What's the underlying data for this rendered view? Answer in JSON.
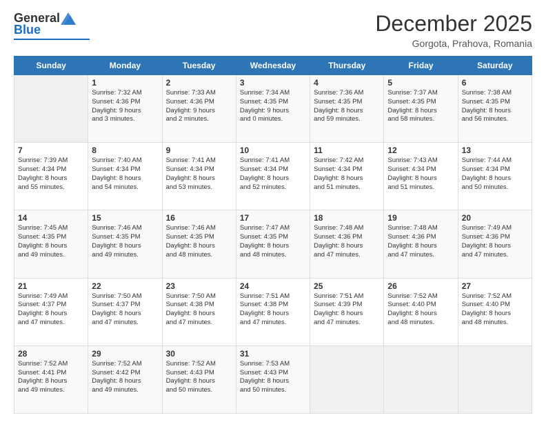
{
  "header": {
    "logo": {
      "general": "General",
      "blue": "Blue"
    },
    "title": "December 2025",
    "location": "Gorgota, Prahova, Romania"
  },
  "days": [
    "Sunday",
    "Monday",
    "Tuesday",
    "Wednesday",
    "Thursday",
    "Friday",
    "Saturday"
  ],
  "weeks": [
    [
      {
        "day": "",
        "content": ""
      },
      {
        "day": "1",
        "content": "Sunrise: 7:32 AM\nSunset: 4:36 PM\nDaylight: 9 hours\nand 3 minutes."
      },
      {
        "day": "2",
        "content": "Sunrise: 7:33 AM\nSunset: 4:36 PM\nDaylight: 9 hours\nand 2 minutes."
      },
      {
        "day": "3",
        "content": "Sunrise: 7:34 AM\nSunset: 4:35 PM\nDaylight: 9 hours\nand 0 minutes."
      },
      {
        "day": "4",
        "content": "Sunrise: 7:36 AM\nSunset: 4:35 PM\nDaylight: 8 hours\nand 59 minutes."
      },
      {
        "day": "5",
        "content": "Sunrise: 7:37 AM\nSunset: 4:35 PM\nDaylight: 8 hours\nand 58 minutes."
      },
      {
        "day": "6",
        "content": "Sunrise: 7:38 AM\nSunset: 4:35 PM\nDaylight: 8 hours\nand 56 minutes."
      }
    ],
    [
      {
        "day": "7",
        "content": "Sunrise: 7:39 AM\nSunset: 4:34 PM\nDaylight: 8 hours\nand 55 minutes."
      },
      {
        "day": "8",
        "content": "Sunrise: 7:40 AM\nSunset: 4:34 PM\nDaylight: 8 hours\nand 54 minutes."
      },
      {
        "day": "9",
        "content": "Sunrise: 7:41 AM\nSunset: 4:34 PM\nDaylight: 8 hours\nand 53 minutes."
      },
      {
        "day": "10",
        "content": "Sunrise: 7:41 AM\nSunset: 4:34 PM\nDaylight: 8 hours\nand 52 minutes."
      },
      {
        "day": "11",
        "content": "Sunrise: 7:42 AM\nSunset: 4:34 PM\nDaylight: 8 hours\nand 51 minutes."
      },
      {
        "day": "12",
        "content": "Sunrise: 7:43 AM\nSunset: 4:34 PM\nDaylight: 8 hours\nand 51 minutes."
      },
      {
        "day": "13",
        "content": "Sunrise: 7:44 AM\nSunset: 4:34 PM\nDaylight: 8 hours\nand 50 minutes."
      }
    ],
    [
      {
        "day": "14",
        "content": "Sunrise: 7:45 AM\nSunset: 4:35 PM\nDaylight: 8 hours\nand 49 minutes."
      },
      {
        "day": "15",
        "content": "Sunrise: 7:46 AM\nSunset: 4:35 PM\nDaylight: 8 hours\nand 49 minutes."
      },
      {
        "day": "16",
        "content": "Sunrise: 7:46 AM\nSunset: 4:35 PM\nDaylight: 8 hours\nand 48 minutes."
      },
      {
        "day": "17",
        "content": "Sunrise: 7:47 AM\nSunset: 4:35 PM\nDaylight: 8 hours\nand 48 minutes."
      },
      {
        "day": "18",
        "content": "Sunrise: 7:48 AM\nSunset: 4:36 PM\nDaylight: 8 hours\nand 47 minutes."
      },
      {
        "day": "19",
        "content": "Sunrise: 7:48 AM\nSunset: 4:36 PM\nDaylight: 8 hours\nand 47 minutes."
      },
      {
        "day": "20",
        "content": "Sunrise: 7:49 AM\nSunset: 4:36 PM\nDaylight: 8 hours\nand 47 minutes."
      }
    ],
    [
      {
        "day": "21",
        "content": "Sunrise: 7:49 AM\nSunset: 4:37 PM\nDaylight: 8 hours\nand 47 minutes."
      },
      {
        "day": "22",
        "content": "Sunrise: 7:50 AM\nSunset: 4:37 PM\nDaylight: 8 hours\nand 47 minutes."
      },
      {
        "day": "23",
        "content": "Sunrise: 7:50 AM\nSunset: 4:38 PM\nDaylight: 8 hours\nand 47 minutes."
      },
      {
        "day": "24",
        "content": "Sunrise: 7:51 AM\nSunset: 4:38 PM\nDaylight: 8 hours\nand 47 minutes."
      },
      {
        "day": "25",
        "content": "Sunrise: 7:51 AM\nSunset: 4:39 PM\nDaylight: 8 hours\nand 47 minutes."
      },
      {
        "day": "26",
        "content": "Sunrise: 7:52 AM\nSunset: 4:40 PM\nDaylight: 8 hours\nand 48 minutes."
      },
      {
        "day": "27",
        "content": "Sunrise: 7:52 AM\nSunset: 4:40 PM\nDaylight: 8 hours\nand 48 minutes."
      }
    ],
    [
      {
        "day": "28",
        "content": "Sunrise: 7:52 AM\nSunset: 4:41 PM\nDaylight: 8 hours\nand 49 minutes."
      },
      {
        "day": "29",
        "content": "Sunrise: 7:52 AM\nSunset: 4:42 PM\nDaylight: 8 hours\nand 49 minutes."
      },
      {
        "day": "30",
        "content": "Sunrise: 7:52 AM\nSunset: 4:43 PM\nDaylight: 8 hours\nand 50 minutes."
      },
      {
        "day": "31",
        "content": "Sunrise: 7:53 AM\nSunset: 4:43 PM\nDaylight: 8 hours\nand 50 minutes."
      },
      {
        "day": "",
        "content": ""
      },
      {
        "day": "",
        "content": ""
      },
      {
        "day": "",
        "content": ""
      }
    ]
  ]
}
